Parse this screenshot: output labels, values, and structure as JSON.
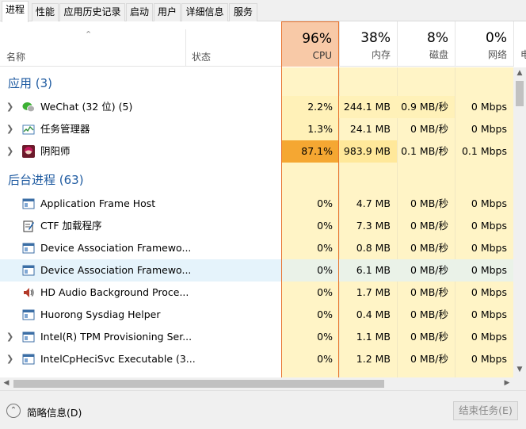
{
  "tabs": [
    "进程",
    "性能",
    "应用历史记录",
    "启动",
    "用户",
    "详细信息",
    "服务"
  ],
  "header": {
    "name_label": "名称",
    "status_label": "状态",
    "cpu": {
      "pct": "96%",
      "label": "CPU"
    },
    "mem": {
      "pct": "38%",
      "label": "内存"
    },
    "disk": {
      "pct": "8%",
      "label": "磁盘"
    },
    "net": {
      "pct": "0%",
      "label": "网络"
    },
    "power_label": "电"
  },
  "groups": {
    "apps_title": "应用 (3)",
    "bg_title": "后台进程 (63)"
  },
  "apps": [
    {
      "name": "WeChat (32 位) (5)",
      "icon": "wechat-icon",
      "cpu": "2.2%",
      "mem": "244.1 MB",
      "disk": "0.9 MB/秒",
      "net": "0 Mbps"
    },
    {
      "name": "任务管理器",
      "icon": "task-manager-icon",
      "cpu": "1.3%",
      "mem": "24.1 MB",
      "disk": "0 MB/秒",
      "net": "0 Mbps"
    },
    {
      "name": "阴阳师",
      "icon": "onmyoji-icon",
      "cpu": "87.1%",
      "mem": "983.9 MB",
      "disk": "0.1 MB/秒",
      "net": "0.1 Mbps"
    }
  ],
  "background": [
    {
      "name": "Application Frame Host",
      "cpu": "0%",
      "mem": "4.7 MB",
      "disk": "0 MB/秒",
      "net": "0 Mbps"
    },
    {
      "name": "CTF 加载程序",
      "cpu": "0%",
      "mem": "7.3 MB",
      "disk": "0 MB/秒",
      "net": "0 Mbps"
    },
    {
      "name": "Device Association Framewo...",
      "cpu": "0%",
      "mem": "0.8 MB",
      "disk": "0 MB/秒",
      "net": "0 Mbps"
    },
    {
      "name": "Device Association Framewo...",
      "cpu": "0%",
      "mem": "6.1 MB",
      "disk": "0 MB/秒",
      "net": "0 Mbps"
    },
    {
      "name": "HD Audio Background Proce...",
      "cpu": "0%",
      "mem": "1.7 MB",
      "disk": "0 MB/秒",
      "net": "0 Mbps"
    },
    {
      "name": "Huorong Sysdiag Helper",
      "cpu": "0%",
      "mem": "0.4 MB",
      "disk": "0 MB/秒",
      "net": "0 Mbps"
    },
    {
      "name": "Intel(R) TPM Provisioning Ser...",
      "cpu": "0%",
      "mem": "1.1 MB",
      "disk": "0 MB/秒",
      "net": "0 Mbps"
    },
    {
      "name": "IntelCpHeciSvc Executable (3...",
      "cpu": "0%",
      "mem": "1.2 MB",
      "disk": "0 MB/秒",
      "net": "0 Mbps"
    }
  ],
  "footer": {
    "fewer_details": "简略信息(D)",
    "end_task": "结束任务(E)"
  }
}
